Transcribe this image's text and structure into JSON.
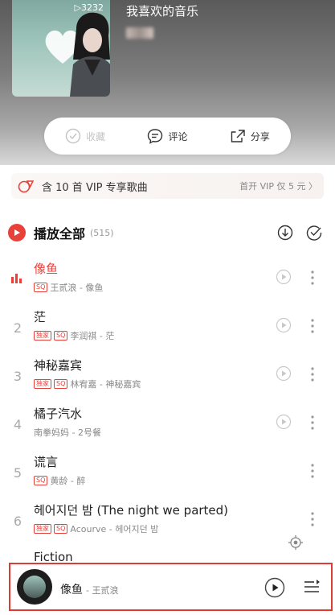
{
  "header": {
    "title": "我喜欢的音乐",
    "play_count": "▷3232"
  },
  "actions": [
    {
      "label": "收藏",
      "icon": "check-circle-icon",
      "enabled": false
    },
    {
      "label": "评论",
      "icon": "comment-icon",
      "enabled": true
    },
    {
      "label": "分享",
      "icon": "share-icon",
      "enabled": true
    }
  ],
  "vip_bar": {
    "text": "含 10 首 VIP 专享歌曲",
    "open_text": "首开 VIP 仅 5 元 〉"
  },
  "play_all": {
    "label": "播放全部",
    "count": "(515)"
  },
  "songs": [
    {
      "index": "",
      "name": "像鱼",
      "tags": [
        "SQ"
      ],
      "meta": "王贰浪 - 像鱼",
      "playing": true
    },
    {
      "index": "2",
      "name": "茫",
      "tags": [
        "独家",
        "SQ"
      ],
      "meta": "李润祺 - 茫",
      "playing": false
    },
    {
      "index": "3",
      "name": "神秘嘉宾",
      "tags": [
        "独家",
        "SQ"
      ],
      "meta": "林宥嘉 - 神秘嘉宾",
      "playing": false
    },
    {
      "index": "4",
      "name": "橘子汽水",
      "tags": [],
      "meta": "南拳妈妈 - 2号餐",
      "playing": false
    },
    {
      "index": "5",
      "name": "谎言",
      "tags": [
        "SQ"
      ],
      "meta": "黄龄 - 醉",
      "playing": false
    },
    {
      "index": "6",
      "name": "헤어지던 밤 (The night we parted)",
      "tags": [
        "独家",
        "SQ"
      ],
      "meta": "Acourve - 헤어지던 밤",
      "playing": false
    },
    {
      "index": "7",
      "name": "Fiction",
      "tags": [],
      "meta": "",
      "playing": false
    }
  ],
  "mini_player": {
    "name": "像鱼",
    "artist": "- 王贰浪"
  },
  "colors": {
    "accent": "#e8413a",
    "highlight_border": "#e03a32"
  }
}
